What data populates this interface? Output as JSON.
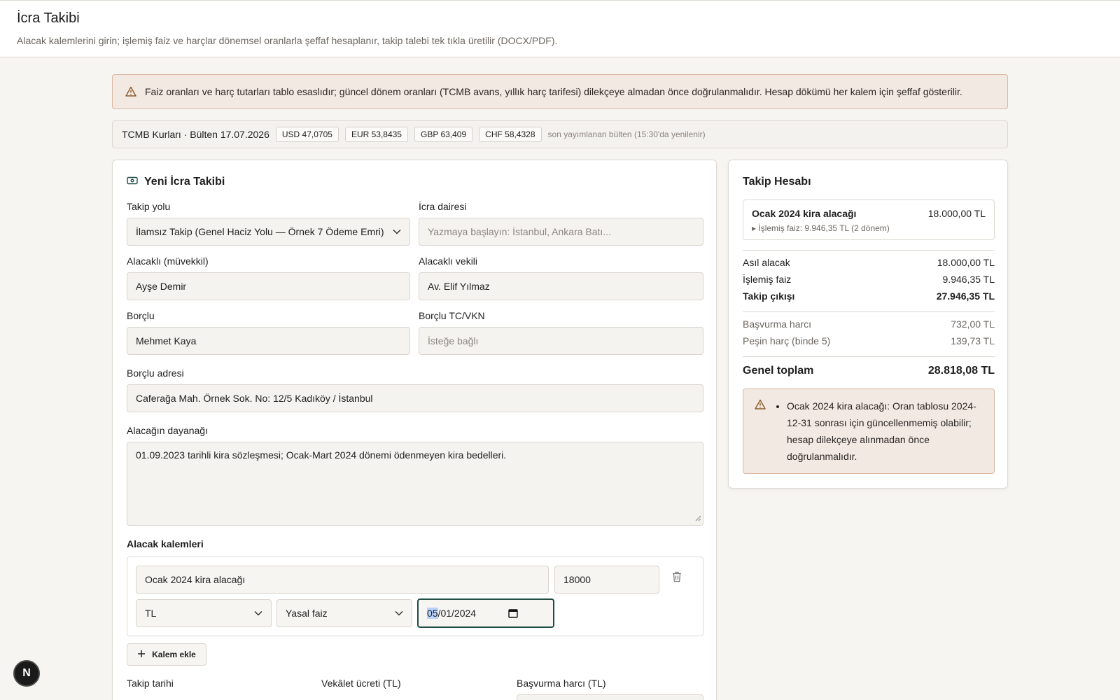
{
  "header": {
    "title": "İcra Takibi",
    "subtitle": "Alacak kalemlerini girin; işlemiş faiz ve harçlar dönemsel oranlarla şeffaf hesaplanır, takip talebi tek tıkla üretilir (DOCX/PDF)."
  },
  "alert": {
    "icon": "warning-icon",
    "text": "Faiz oranları ve harç tutarları tablo esaslıdır; güncel dönem oranları (TCMB avans, yıllık harç tarifesi) dilekçeye almadan önce doğrulanmalıdır. Hesap dökümü her kalem için şeffaf gösterilir."
  },
  "rates": {
    "title": "TCMB Kurları · Bülten 17.07.2026",
    "chips": [
      "USD 47,0705",
      "EUR 53,8435",
      "GBP 63,409",
      "CHF 58,4328"
    ],
    "note": "son yayımlanan bülten (15:30'da yenilenir)"
  },
  "form": {
    "title": "Yeni İcra Takibi",
    "takip_yolu_label": "Takip yolu",
    "takip_yolu_value": "İlamsız Takip (Genel Haciz Yolu — Örnek 7 Ödeme Emri)",
    "icra_dairesi_label": "İcra dairesi",
    "icra_dairesi_placeholder": "Yazmaya başlayın: İstanbul, Ankara Batı...",
    "alacakli_label": "Alacaklı (müvekkil)",
    "alacakli_value": "Ayşe Demir",
    "vekil_label": "Alacaklı vekili",
    "vekil_value": "Av. Elif Yılmaz",
    "borclu_label": "Borçlu",
    "borclu_value": "Mehmet Kaya",
    "borclu_tc_label": "Borçlu TC/VKN",
    "borclu_tc_placeholder": "İsteğe bağlı",
    "adres_label": "Borçlu adresi",
    "adres_value": "Caferağa Mah. Örnek Sok. No: 12/5 Kadıköy / İstanbul",
    "dayanak_label": "Alacağın dayanağı",
    "dayanak_value": "01.09.2023 tarihli kira sözleşmesi; Ocak-Mart 2024 dönemi ödenmeyen kira bedelleri.",
    "kalemler_label": "Alacak kalemleri",
    "kalem": {
      "name": "Ocak 2024 kira alacağı",
      "amount": "18000",
      "currency": "TL",
      "faiz": "Yasal faiz",
      "date_month": "05",
      "date_rest": "/01/2024"
    },
    "add_label": "Kalem ekle",
    "takip_tarihi_label": "Takip tarihi",
    "vekalet_label": "Vekâlet ücreti (TL)",
    "basvurma_label": "Başvurma harcı (TL)"
  },
  "summary": {
    "title": "Takip Hesabı",
    "item_name": "Ocak 2024 kira alacağı",
    "item_amount": "18.000,00 TL",
    "item_detail": "▸ İşlemiş faiz: 9.946,35 TL (2 dönem)",
    "asil_label": "Asıl alacak",
    "asil_value": "18.000,00 TL",
    "faiz_label": "İşlemiş faiz",
    "faiz_value": "9.946,35 TL",
    "cikis_label": "Takip çıkışı",
    "cikis_value": "27.946,35 TL",
    "basvurma_label": "Başvurma harcı",
    "basvurma_value": "732,00 TL",
    "pesin_label": "Peşin harç (binde 5)",
    "pesin_value": "139,73 TL",
    "genel_label": "Genel toplam",
    "genel_value": "28.818,08 TL",
    "warning": "Ocak 2024 kira alacağı: Oran tablosu 2024-12-31 sonrası için güncellenmemiş olabilir; hesap dilekçeye alınmadan önce doğrulanmalıdır."
  },
  "fab": {
    "label": "N"
  },
  "colors": {
    "accent": "#1e4d45",
    "warning_bg": "#f2e9e2",
    "warning_border": "#d9b7a0"
  }
}
